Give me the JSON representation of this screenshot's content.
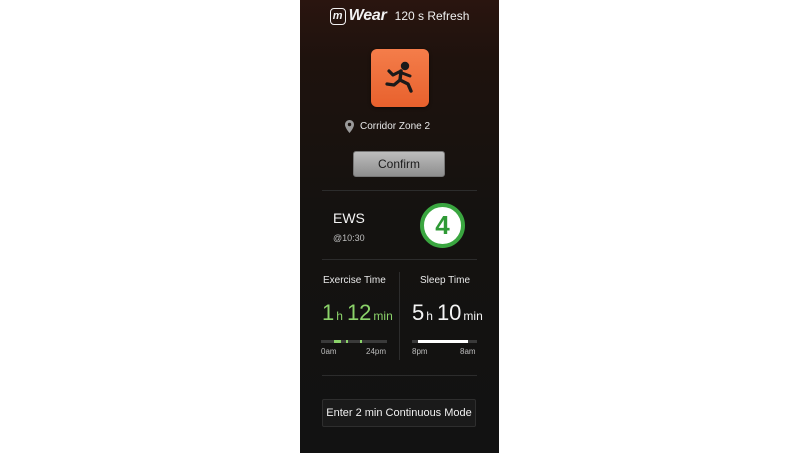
{
  "header": {
    "logo_mark": "m",
    "logo_word": "Wear",
    "refresh": "120 s Refresh"
  },
  "alert": {
    "icon": "fall-person-icon",
    "color": "#ef6f3a",
    "location_icon": "map-pin-icon",
    "location": "Corridor Zone 2",
    "confirm_label": "Confirm"
  },
  "ews": {
    "title": "EWS",
    "time": "@10:30",
    "score": "4",
    "score_color": "#3aa640"
  },
  "exercise": {
    "label": "Exercise Time",
    "hours": "1",
    "hours_unit": "h",
    "minutes": "12",
    "minutes_unit": "min",
    "start_label": "0am",
    "end_label": "24pm",
    "color": "#8bd36a"
  },
  "sleep": {
    "label": "Sleep Time",
    "hours": "5",
    "hours_unit": "h",
    "minutes": "10",
    "minutes_unit": "min",
    "start_label": "8pm",
    "end_label": "8am",
    "color": "#ffffff"
  },
  "continuous_mode_label": "Enter 2 min Continuous Mode"
}
